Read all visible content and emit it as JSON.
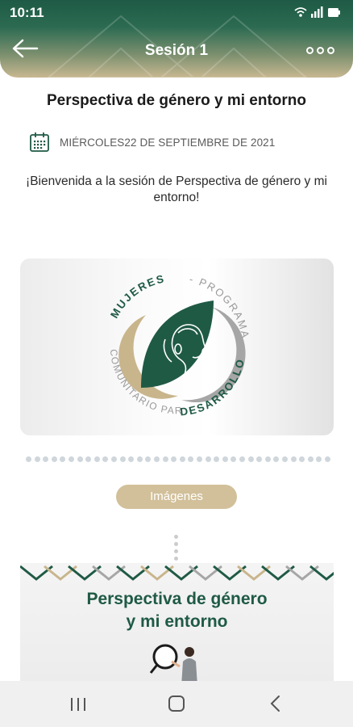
{
  "status": {
    "time": "10:11",
    "icons": [
      "wifi-icon",
      "signal-icon",
      "battery-icon"
    ]
  },
  "header": {
    "title": "Sesión 1",
    "back_icon": "arrow-left-icon",
    "more_icon": "more-horizontal-icon"
  },
  "session": {
    "title": "Perspectiva de género y mi entorno",
    "date": "MIÉRCOLES22 DE SEPTIEMBRE DE 2021",
    "welcome": "¡Bienvenida a la sesión de Perspectiva de género y mi entorno!"
  },
  "logo": {
    "ring_text_green": "MUJERES",
    "ring_text_gray_top": "- PROGRAMA",
    "ring_text_left": "COMUNITARIO PARA",
    "ring_text_right": "DESARROLLO"
  },
  "media_tab": {
    "label": "Imágenes"
  },
  "preview": {
    "title_line1": "Perspectiva de género",
    "title_line2": "y mi entorno"
  },
  "navbar": {
    "items": [
      "recent-apps-icon",
      "home-icon",
      "back-icon"
    ]
  },
  "colors": {
    "brand_green": "#1f5a45",
    "gold": "#d2c09a",
    "gray": "#a6a6a6"
  }
}
